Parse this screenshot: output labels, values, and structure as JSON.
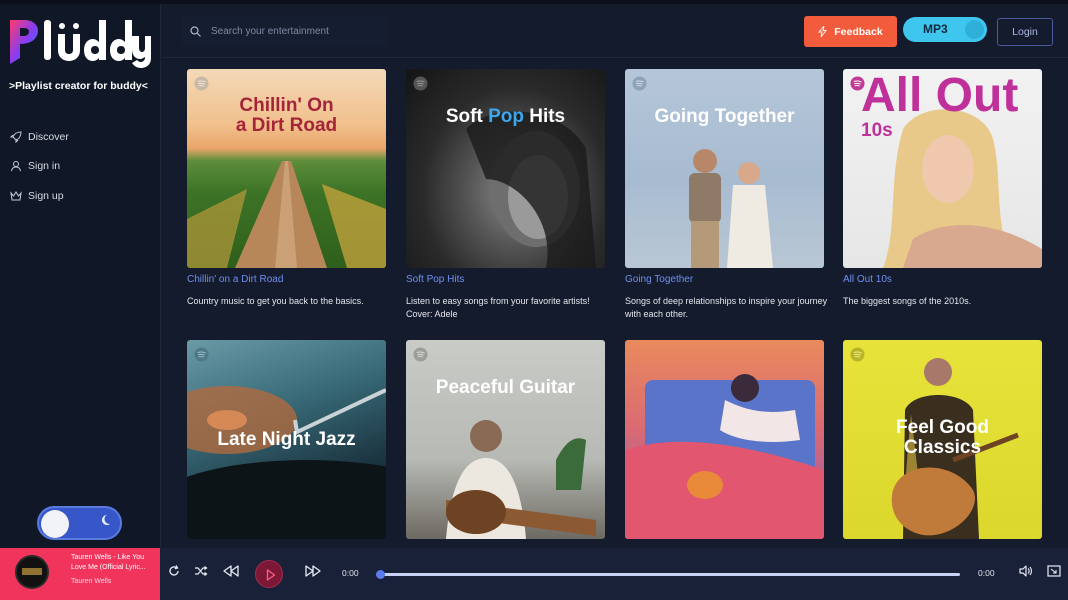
{
  "app": {
    "logo_text": "Pluddy",
    "tagline": ">Playlist creator for buddy<"
  },
  "sidebar": {
    "items": [
      {
        "label": "Discover",
        "icon": "rocket-icon"
      },
      {
        "label": "Sign in",
        "icon": "user-icon"
      },
      {
        "label": "Sign up",
        "icon": "crown-icon"
      }
    ],
    "theme_toggle": {
      "mode": "dark",
      "icon": "moon-icon"
    }
  },
  "header": {
    "search_placeholder": "Search your entertainment",
    "feedback_label": "Feedback",
    "mp3_label": "MP3",
    "login_label": "Login"
  },
  "playlists": [
    {
      "cover_text": [
        "Chillin' On",
        "a Dirt Road"
      ],
      "title": "Chillin' on a Dirt Road",
      "description": "Country music to get you back to the basics."
    },
    {
      "cover_text": [
        "Soft Pop Hits"
      ],
      "title": "Soft Pop Hits",
      "description": "Listen to easy songs from your favorite artists! Cover: Adele"
    },
    {
      "cover_text": [
        "Going Together"
      ],
      "title": "Going Together",
      "description": "Songs of deep relationships to inspire your journey with each other."
    },
    {
      "cover_text": [
        "All Out",
        "10s"
      ],
      "title": "All Out 10s",
      "description": "The biggest songs of the 2010s."
    },
    {
      "cover_text": [
        "Late Night Jazz"
      ],
      "title": "",
      "description": ""
    },
    {
      "cover_text": [
        "Peaceful Guitar"
      ],
      "title": "",
      "description": ""
    },
    {
      "cover_text": [],
      "title": "",
      "description": ""
    },
    {
      "cover_text": [
        "Feel Good",
        "Classics"
      ],
      "title": "",
      "description": ""
    }
  ],
  "player": {
    "track_title": "Tauren Wells - Like You Love Me (Official Lyric...",
    "artist": "Tauren Wells",
    "current_time": "0:00",
    "duration": "0:00",
    "progress": 0
  },
  "colors": {
    "accent_blue": "#6f8ff0",
    "feedback": "#f25c3c",
    "mp3": "#3fc6ee",
    "now_playing": "#f0345b",
    "background": "#141b2d"
  }
}
